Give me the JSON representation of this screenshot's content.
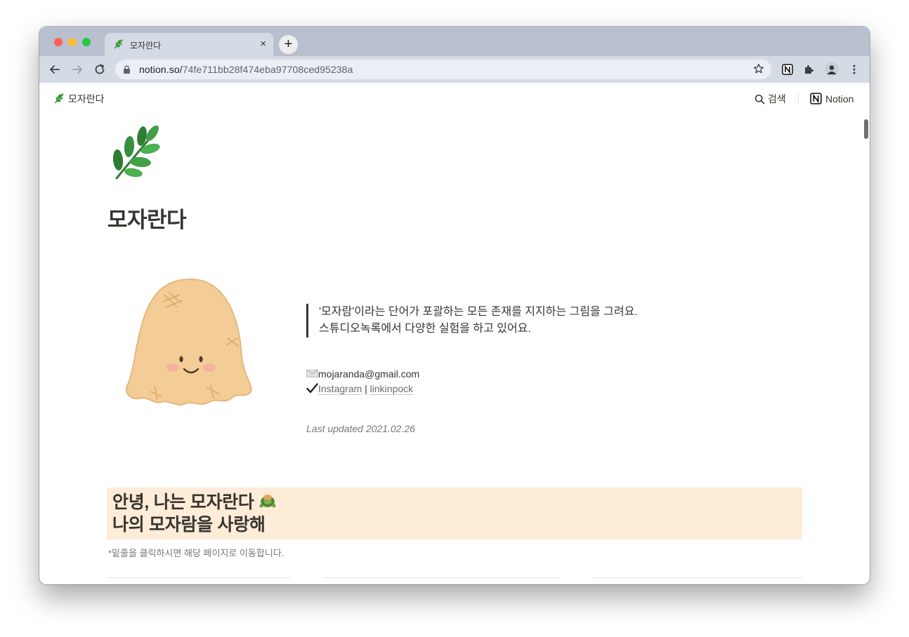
{
  "browser": {
    "tab_title": "모자란다",
    "tab_close": "×",
    "new_tab": "+",
    "url_host": "notion.so/",
    "url_path": "74fe711bb28f474eba97708ced95238a"
  },
  "topbar": {
    "workspace": "모자란다",
    "search_label": "검색",
    "notion_label": "Notion"
  },
  "page": {
    "title": "모자란다",
    "quote_lines": [
      "'모자람'이라는 단어가 포괄하는 모든 존재를 지지하는 그림을 그려요.",
      "스튜디오녹록에서 다양한 실험을 하고 있어요."
    ],
    "email": "mojaranda@gmail.com",
    "link_instagram": "Instagram",
    "link_separator": " | ",
    "link_linkinpock": "linkinpock",
    "last_updated": "Last updated 2021.02.26",
    "callout_line1": "안녕, 나는 모자란다",
    "callout_line2": "나의 모자람을 사랑해",
    "note": "*밑줄을 클릭하시면 해당 페이지로 이동합니다."
  },
  "icons": {
    "page_icon": "herb-icon",
    "email_icon": "envelope-icon",
    "check_icon": "check-mark-icon",
    "callout_icon": "turtle-icon"
  },
  "colors": {
    "callout_bg": "#fdecd8",
    "text": "#37352f",
    "muted": "#787774",
    "chrome_bg": "#b8c0d0"
  }
}
